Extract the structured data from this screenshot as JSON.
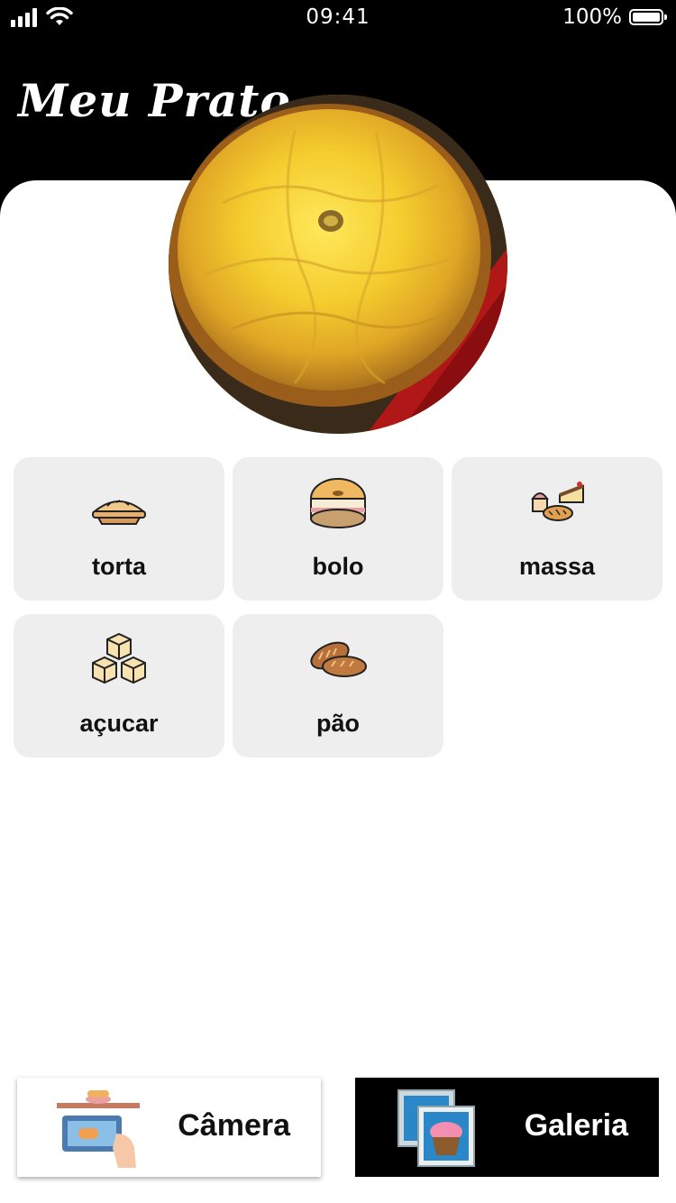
{
  "status": {
    "time": "09:41",
    "battery_label": "100%"
  },
  "header": {
    "title": "Meu Prato"
  },
  "dish": {
    "icon": "pie-photo"
  },
  "categories": [
    {
      "label": "torta",
      "icon": "pie-icon"
    },
    {
      "label": "bolo",
      "icon": "cake-icon"
    },
    {
      "label": "massa",
      "icon": "pastries-icon"
    },
    {
      "label": "açucar",
      "icon": "sugar-cubes-icon"
    },
    {
      "label": "pão",
      "icon": "bread-icon"
    }
  ],
  "actions": {
    "camera_label": "Câmera",
    "gallery_label": "Galeria"
  },
  "colors": {
    "header_bg": "#000000",
    "tile_bg": "#eeeeee",
    "gallery_bg": "#000000"
  }
}
